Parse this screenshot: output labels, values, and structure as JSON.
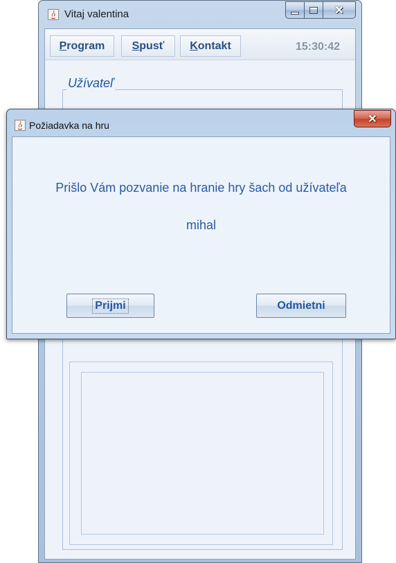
{
  "main_window": {
    "title": "Vitaj valentina",
    "menu": {
      "program": {
        "mnemonic": "P",
        "rest": "rogram"
      },
      "spust": {
        "mnemonic": "S",
        "rest": "pusť"
      },
      "kontakt": {
        "mnemonic": "K",
        "rest": "ontakt"
      }
    },
    "clock": "15:30:42",
    "user_group_label": "Užívateľ"
  },
  "dialog": {
    "title": "Požiadavka na hru",
    "message": "Prišlo Vám pozvanie na hranie hry šach od užívateľa",
    "username": "mihal",
    "accept_label": "Prijmi",
    "reject_label": "Odmietni"
  }
}
